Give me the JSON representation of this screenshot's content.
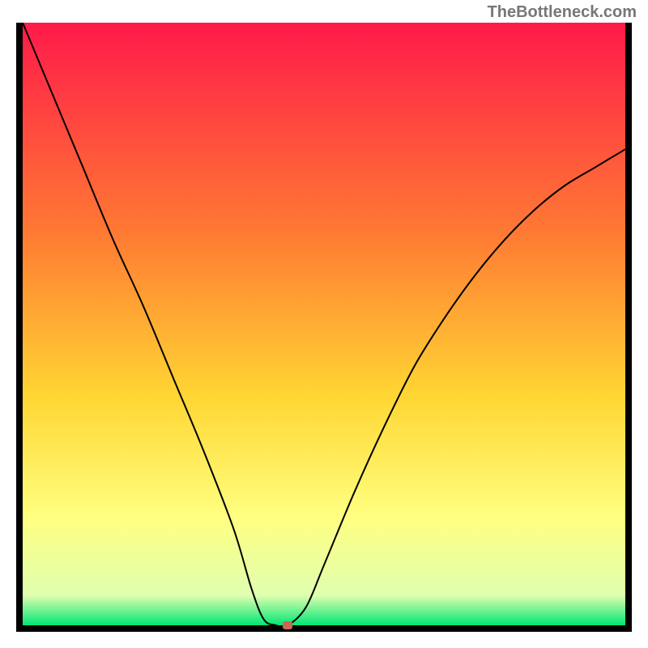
{
  "watermark": "TheBottleneck.com",
  "colors": {
    "bg_top": "#ff1a4a",
    "bg_mid1": "#ff7a33",
    "bg_mid2": "#ffd633",
    "bg_mid3": "#ffff80",
    "bg_bottom": "#00e673",
    "curve": "#000000",
    "marker": "#cc6655",
    "border": "#000000"
  },
  "chart_data": {
    "type": "line",
    "title": "",
    "xlabel": "",
    "ylabel": "",
    "xlim": [
      0,
      100
    ],
    "ylim": [
      0,
      100
    ],
    "series": [
      {
        "name": "curve",
        "x": [
          0,
          5,
          10,
          15,
          20,
          25,
          30,
          35,
          38,
          40,
          42,
          44,
          47,
          50,
          55,
          60,
          65,
          70,
          75,
          80,
          85,
          90,
          95,
          100
        ],
        "y": [
          100,
          88,
          76,
          64,
          53,
          41,
          29,
          16,
          6,
          1,
          0,
          0,
          3,
          10,
          22,
          33,
          43,
          51,
          58,
          64,
          69,
          73,
          76,
          79
        ]
      }
    ],
    "marker": {
      "x": 44,
      "y": 0
    },
    "gradient_stops": [
      {
        "offset": 0,
        "color": "#ff1a4a"
      },
      {
        "offset": 35,
        "color": "#ff7a33"
      },
      {
        "offset": 62,
        "color": "#ffd633"
      },
      {
        "offset": 82,
        "color": "#ffff80"
      },
      {
        "offset": 95,
        "color": "#e0ffb0"
      },
      {
        "offset": 100,
        "color": "#00e673"
      }
    ]
  }
}
